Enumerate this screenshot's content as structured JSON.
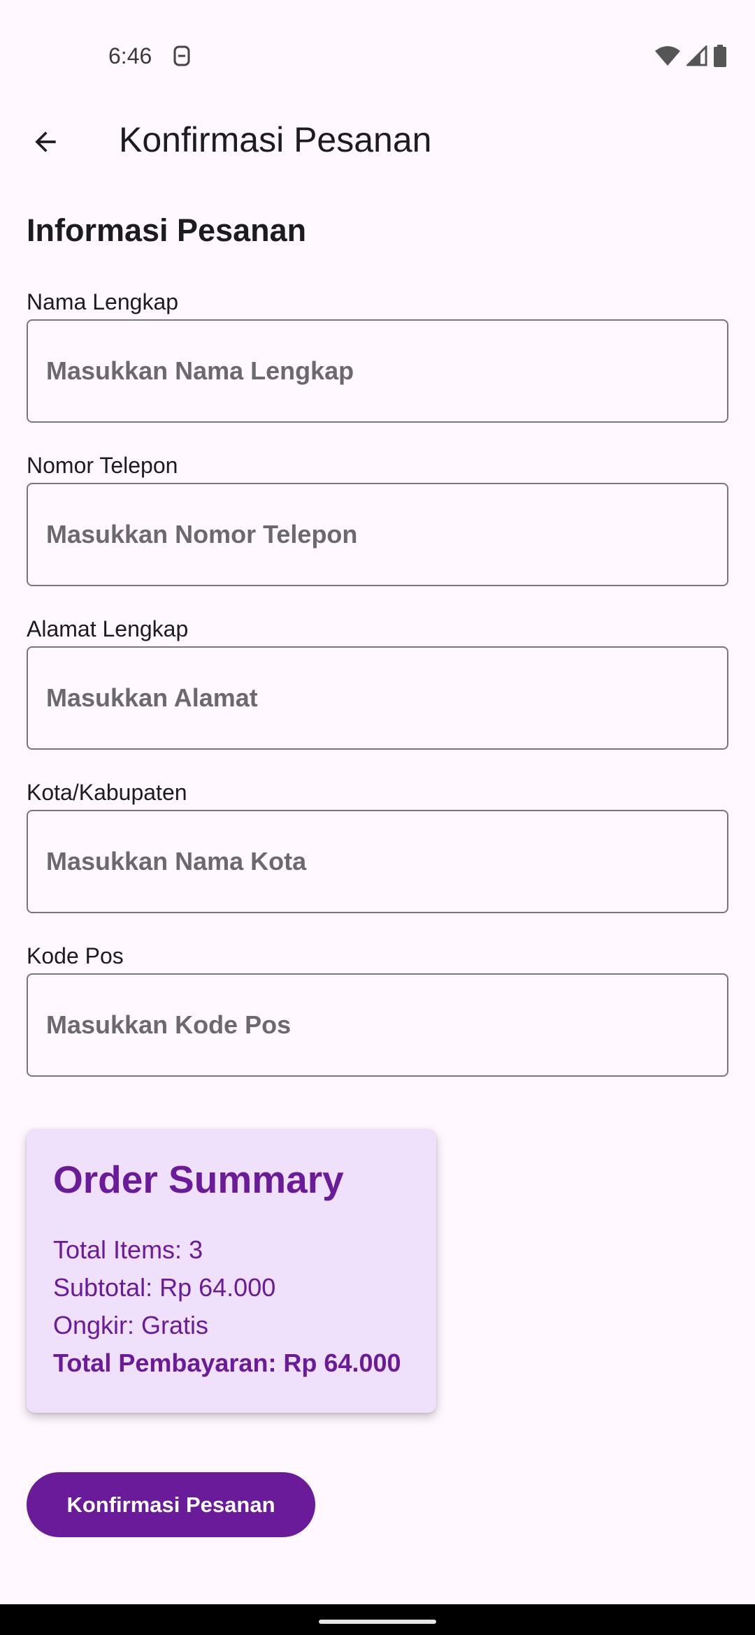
{
  "status_bar": {
    "time": "6:46"
  },
  "app_bar": {
    "title": "Konfirmasi Pesanan"
  },
  "form": {
    "section_title": "Informasi Pesanan",
    "fields": [
      {
        "label": "Nama Lengkap",
        "placeholder": "Masukkan Nama Lengkap",
        "value": ""
      },
      {
        "label": "Nomor Telepon",
        "placeholder": "Masukkan Nomor Telepon",
        "value": ""
      },
      {
        "label": "Alamat Lengkap",
        "placeholder": "Masukkan Alamat",
        "value": ""
      },
      {
        "label": "Kota/Kabupaten",
        "placeholder": "Masukkan Nama Kota",
        "value": ""
      },
      {
        "label": "Kode Pos",
        "placeholder": "Masukkan Kode Pos",
        "value": ""
      }
    ]
  },
  "summary": {
    "title": "Order Summary",
    "total_items": "Total Items: 3",
    "subtotal": "Subtotal: Rp 64.000",
    "shipping": "Ongkir: Gratis",
    "total_payment": "Total Pembayaran: Rp 64.000"
  },
  "actions": {
    "confirm_label": "Konfirmasi Pesanan"
  },
  "colors": {
    "primary": "#6A1B9A",
    "card_background": "#EFE0FB",
    "page_background": "#FFF8FE"
  }
}
